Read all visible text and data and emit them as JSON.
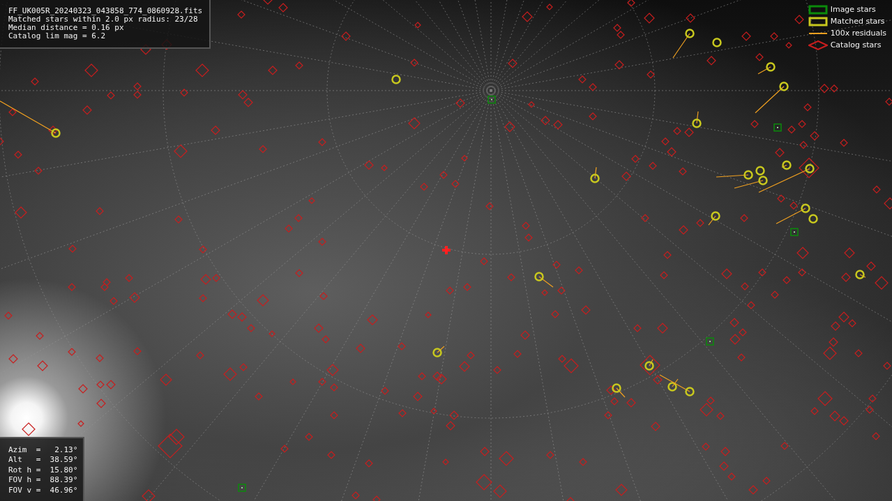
{
  "info_panel": {
    "lines": [
      "FF_UK005R_20240323_043858_774_0860928.fits",
      "Matched stars within 2.0 px radius: 23/28",
      "Median distance = 0.16 px",
      "Catalog lim mag = 6.2"
    ]
  },
  "legend": [
    {
      "kind": "image",
      "label": "Image stars",
      "color": "#0b8a0b"
    },
    {
      "kind": "matched",
      "label": "Matched stars",
      "color": "#c8c81e"
    },
    {
      "kind": "residual",
      "label": "100x residuals",
      "color": "#f0a020"
    },
    {
      "kind": "catalog",
      "label": "Catalog stars",
      "color": "#c81e1e"
    }
  ],
  "pointing_panel": {
    "lines": [
      "Azim  =   2.13°",
      "Alt   =  38.59°",
      "Rot h =  15.80°",
      "FOV h =  88.39°",
      "FOV v =  46.96°"
    ]
  }
}
